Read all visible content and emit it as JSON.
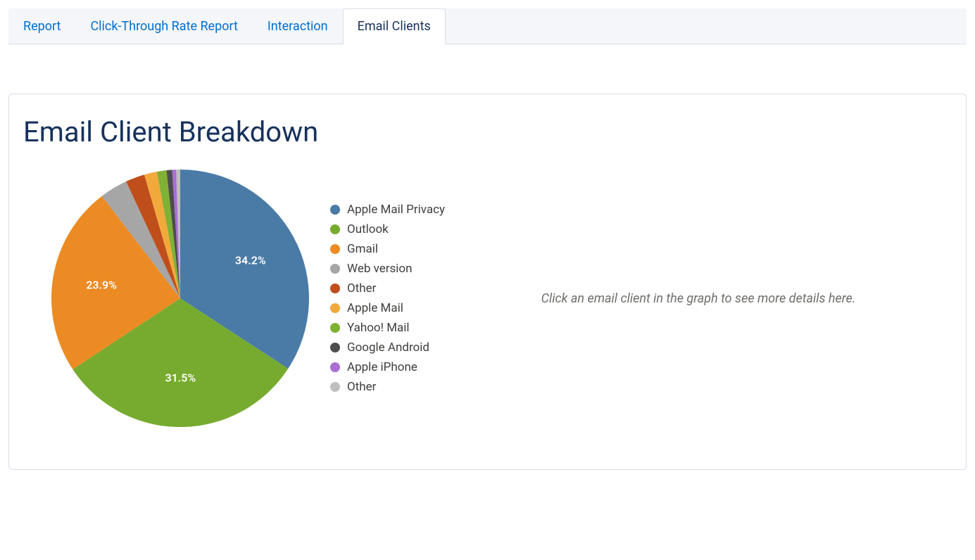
{
  "tabs": [
    {
      "label": "Report",
      "active": false
    },
    {
      "label": "Click-Through Rate Report",
      "active": false
    },
    {
      "label": "Interaction",
      "active": false
    },
    {
      "label": "Email Clients",
      "active": true
    }
  ],
  "card": {
    "title": "Email Client Breakdown",
    "hint": "Click an email client in the graph to see more details here."
  },
  "chart_data": {
    "type": "pie",
    "title": "Email Client Breakdown",
    "series": [
      {
        "name": "Apple Mail Privacy",
        "value": 34.2,
        "color": "#4a7ba6",
        "show_label": true
      },
      {
        "name": "Outlook",
        "value": 31.5,
        "color": "#77ab2f",
        "show_label": true
      },
      {
        "name": "Gmail",
        "value": 23.9,
        "color": "#ec8b23",
        "show_label": true
      },
      {
        "name": "Web version",
        "value": 3.5,
        "color": "#a6a6a6",
        "show_label": false
      },
      {
        "name": "Other",
        "value": 2.4,
        "color": "#bf4e1b",
        "show_label": false
      },
      {
        "name": "Apple Mail",
        "value": 1.6,
        "color": "#f2a93b",
        "show_label": false
      },
      {
        "name": "Yahoo! Mail",
        "value": 1.2,
        "color": "#7fb135",
        "show_label": false
      },
      {
        "name": "Google Android",
        "value": 0.7,
        "color": "#4d4d4d",
        "show_label": false
      },
      {
        "name": "Apple iPhone",
        "value": 0.5,
        "color": "#a86fd1",
        "show_label": false
      },
      {
        "name": "Other",
        "value": 0.5,
        "color": "#bfbfbf",
        "show_label": false
      }
    ]
  }
}
